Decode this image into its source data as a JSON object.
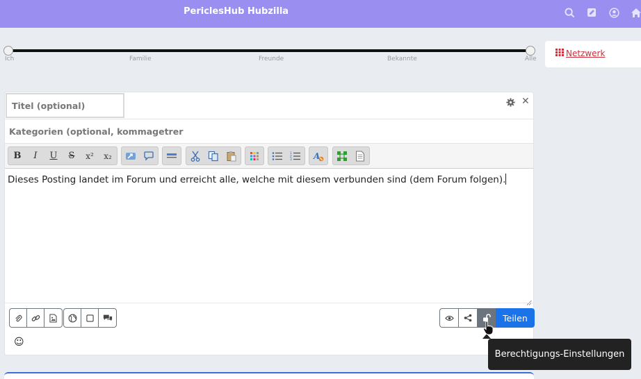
{
  "navbar": {
    "title": "PericlesHub Hubzilla",
    "icons": [
      "search-icon",
      "edit-icon",
      "user-icon",
      "home-icon"
    ],
    "bg_color": "#9a8ff0"
  },
  "slider": {
    "labels": [
      "Ich",
      "Familie",
      "Freunde",
      "Bekannte",
      "Alle"
    ]
  },
  "widget": {
    "network_label": "Netzwerk",
    "icon": "grid-icon"
  },
  "editor": {
    "title_placeholder": "Titel (optional)",
    "category_placeholder": "Kategorien (optional, kommagetrer",
    "body_text": "Dieses Posting landet im Forum und erreicht alle, welche mit diesem verbunden sind (dem Forum folgen).",
    "toolbar": {
      "bold": "B",
      "italic": "I",
      "underline": "U",
      "strike": "S",
      "superscript": "x²",
      "subscript": "x₂"
    },
    "share_label": "Teilen",
    "accent": "#1a73e8",
    "emoji": "☺"
  },
  "tooltip": {
    "text": "Berechtigungs-Einstellungen"
  }
}
